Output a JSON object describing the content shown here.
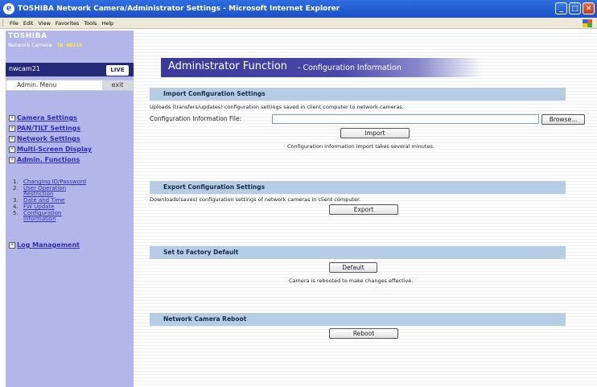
{
  "window": {
    "title": "TOSHIBA Network Camera/Administrator Settings - Microsoft Internet Explorer"
  },
  "menu": [
    "File",
    "Edit",
    "View",
    "Favorites",
    "Tools",
    "Help"
  ],
  "sidebar": {
    "brand": "TOSHIBA",
    "product": "Network Camera",
    "model": "IK-WB21A",
    "camera_name": "nwcam21",
    "live_label": "LIVE",
    "admin_menu_label": "Admin. Menu",
    "exit_label": "exit",
    "nav": [
      "Camera Settings",
      "PAN/TILT Settings",
      "Network Settings",
      "Multi-Screen Display",
      "Admin. Functions"
    ],
    "admin_sub": [
      {
        "n": "1.",
        "lines": [
          "Changing ID/Password"
        ]
      },
      {
        "n": "2.",
        "lines": [
          "User Operation",
          "Restriction"
        ]
      },
      {
        "n": "3.",
        "lines": [
          "Date and Time"
        ]
      },
      {
        "n": "4.",
        "lines": [
          "FW Update"
        ]
      },
      {
        "n": "5.",
        "lines": [
          "Configuration",
          "Information"
        ]
      }
    ],
    "log": "Log Management"
  },
  "main": {
    "banner_title": "Administrator Function",
    "banner_sub": "- Configuration Information",
    "import": {
      "heading": "Import Configuration Settings",
      "desc": "Uploads (transfers/updates) configuration settings saved in client computer to network cameras.",
      "field_label": "Configuration Information File:",
      "field_value": "",
      "browse_label": "Browse...",
      "button": "Import",
      "note": "Configuration information import takes several minutes."
    },
    "export": {
      "heading": "Export Configuration Settings",
      "desc": "Downloads(saves) configuration settings of network cameras in client computer.",
      "button": "Export"
    },
    "factory": {
      "heading": "Set to Factory Default",
      "button": "Default",
      "note": "Camera is rebooted to make changes effective."
    },
    "reboot": {
      "heading": "Network Camera Reboot",
      "button": "Reboot"
    }
  }
}
